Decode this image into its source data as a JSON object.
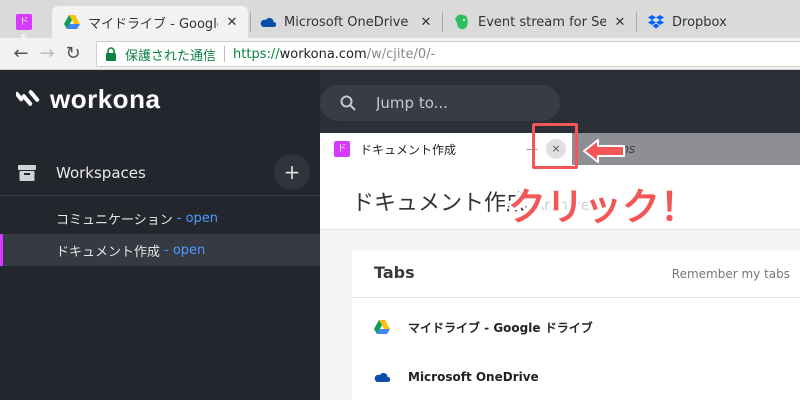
{
  "browser": {
    "tabs": [
      {
        "title": "",
        "favicon": "doc-icon",
        "favicon_text": "ドキ",
        "active": false
      },
      {
        "title": "マイドライブ - Google",
        "favicon": "google-drive-icon",
        "active": true
      },
      {
        "title": "Microsoft OneDrive",
        "favicon": "onedrive-icon",
        "active": false
      },
      {
        "title": "Event stream for Septen",
        "favicon": "evernote-icon",
        "active": false
      },
      {
        "title": "Dropbox",
        "favicon": "dropbox-icon",
        "active": false
      }
    ],
    "close_glyph": "✕",
    "nav": {
      "back": "←",
      "forward": "→",
      "reload": "↻"
    },
    "security_label": "保護された通信",
    "url": {
      "scheme": "https://",
      "host": "workona.com",
      "path": "/w/cjite/0/-"
    }
  },
  "app": {
    "logo_text": "workona",
    "search_placeholder": "Jump to...",
    "workspaces_title": "Workspaces",
    "add_glyph": "+",
    "workspaces": [
      {
        "name": "コミュニケーション",
        "status": "- open",
        "active": false
      },
      {
        "name": "ドキュメント作成",
        "status": "- open",
        "active": true
      }
    ]
  },
  "panel": {
    "doc_tab_title": "ドキュメント作成",
    "doc_tab_favicon_text": "ド",
    "dash": "—",
    "close_glyph": "×",
    "grey_tab_text": "ons",
    "heading": "ドキュメント作成",
    "heading_ghost": "Archive",
    "tabs_title": "Tabs",
    "remember_label": "Remember my tabs",
    "tab_rows": [
      {
        "icon": "google-drive-icon",
        "title": "マイドライブ - Google ドライブ"
      },
      {
        "icon": "onedrive-icon",
        "title": "Microsoft OneDrive"
      }
    ]
  },
  "annotation": {
    "text": "クリック！",
    "arrow": "←",
    "color": "#f25656"
  },
  "colors": {
    "accent": "#d63aff",
    "link_blue": "#4b9bff",
    "secure_green": "#0b8043",
    "sidebar_bg": "#23262d"
  }
}
